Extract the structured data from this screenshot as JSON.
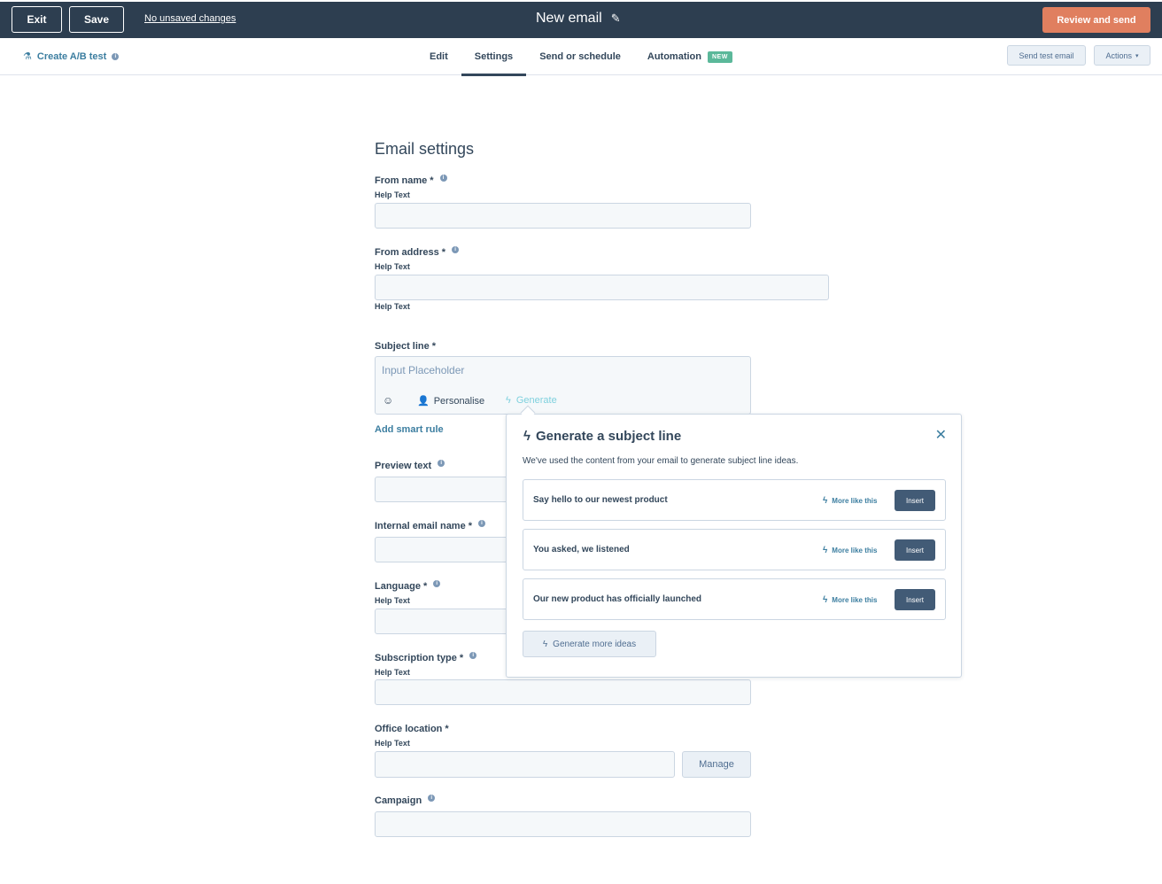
{
  "topbar": {
    "exit_label": "Exit",
    "save_label": "Save",
    "unsaved_text": "No unsaved changes",
    "title": "New email",
    "review_label": "Review and send"
  },
  "subnav": {
    "ab_test_label": "Create A/B test",
    "tabs": [
      {
        "label": "Edit"
      },
      {
        "label": "Settings",
        "active": true
      },
      {
        "label": "Send or schedule"
      },
      {
        "label": "Automation",
        "badge": "NEW"
      }
    ],
    "send_test_label": "Send test email",
    "actions_label": "Actions"
  },
  "form": {
    "title": "Email settings",
    "from_name": {
      "label": "From name",
      "required": "*",
      "help": "Help Text"
    },
    "from_address": {
      "label": "From address",
      "required": "*",
      "help": "Help Text",
      "help_below": "Help Text"
    },
    "subject_line": {
      "label": "Subject line",
      "required": "*",
      "placeholder": "Input Placeholder",
      "personalise": "Personalise",
      "generate": "Generate"
    },
    "add_smart_rule": "Add smart rule",
    "preview_text": {
      "label": "Preview text"
    },
    "internal_name": {
      "label": "Internal email name",
      "required": "*"
    },
    "language": {
      "label": "Language",
      "required": "*",
      "help": "Help Text"
    },
    "subscription_type": {
      "label": "Subscription type",
      "required": "*",
      "help": "Help Text"
    },
    "office_location": {
      "label": "Office location",
      "required": "*",
      "help": "Help Text",
      "manage_label": "Manage"
    },
    "campaign": {
      "label": "Campaign"
    }
  },
  "popover": {
    "title": "Generate a subject line",
    "description": "We've used the content from your email to generate subject line ideas.",
    "ideas": [
      {
        "text": "Say hello to our newest product",
        "more": "More like this",
        "insert": "Insert"
      },
      {
        "text": "You asked, we listened",
        "more": "More like this",
        "insert": "Insert"
      },
      {
        "text": "Our new product has officially launched",
        "more": "More like this",
        "insert": "Insert"
      }
    ],
    "generate_more": "Generate more ideas"
  },
  "colors": {
    "topbar_bg": "#2d3e50",
    "primary_cta": "#e07f5f",
    "link": "#3c7ea0",
    "badge_new": "#5bb89a",
    "insert_btn": "#425b76"
  },
  "icons": {
    "pencil": "pencil-icon",
    "flask": "flask-icon",
    "info": "info-icon",
    "caret": "caret-down-icon",
    "emoji": "emoji-icon",
    "person": "person-icon",
    "bolt": "lightning-icon",
    "close": "close-icon"
  }
}
